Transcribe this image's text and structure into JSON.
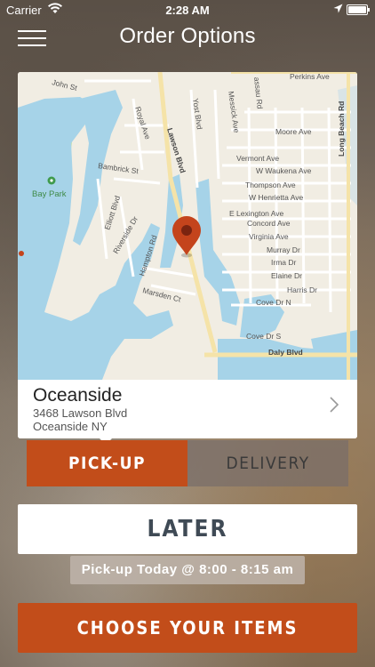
{
  "status_bar": {
    "carrier": "Carrier",
    "time": "2:28 AM"
  },
  "header": {
    "title": "Order Options",
    "menu_icon": "hamburger-menu-icon"
  },
  "map": {
    "labels": {
      "john_st": "John St",
      "royal_ave": "Royal Ave",
      "lawson_blvd": "Lawson Blvd",
      "yost_blvd": "Yost Blvd",
      "messick_ave": "Messick Ave",
      "assau_rd": "assau Rd",
      "perkins_ave": "Perkins Ave",
      "long_beach_rd": "Long Beach Rd",
      "moore_ave": "Moore Ave",
      "vermont_ave": "Vermont Ave",
      "w_waukena_ave": "W Waukena Ave",
      "thompson_ave": "Thompson Ave",
      "w_henrietta_ave": "W Henrietta Ave",
      "e_lexington_ave": "E Lexington Ave",
      "concord_ave": "Concord Ave",
      "virginia_ave": "Virginia Ave",
      "murray_dr": "Murray Dr",
      "irma_dr": "Irma Dr",
      "elaine_dr": "Elaine Dr",
      "harris_dr": "Harris Dr",
      "cove_dr_n": "Cove Dr N",
      "cove_dr_s": "Cove Dr S",
      "daly_blvd": "Daly Blvd",
      "bambrick_st": "Bambrick St",
      "bay_park": "Bay Park",
      "elliott_blvd": "Elliott Blvd",
      "riverside_dr": "Riverside Dr",
      "hampton_rd": "Hampton Rd",
      "marsden_ct": "Marsden Ct"
    },
    "colors": {
      "land": "#f1ede3",
      "water": "#a6d3e8",
      "park": "#bfe0b0",
      "pin": "#c4441c"
    }
  },
  "location": {
    "name": "Oceanside",
    "address_line1": "3468 Lawson Blvd",
    "address_line2": "Oceanside NY"
  },
  "order_type": {
    "pickup_label": "PICK-UP",
    "delivery_label": "DELIVERY",
    "selected": "pickup"
  },
  "timing": {
    "later_label": "LATER",
    "pickup_time": "Pick-up Today @ 8:00 - 8:15 am"
  },
  "actions": {
    "choose_label": "CHOOSE YOUR ITEMS"
  },
  "colors": {
    "accent": "#c24d1a",
    "tab_inactive": "#7a6e69"
  }
}
